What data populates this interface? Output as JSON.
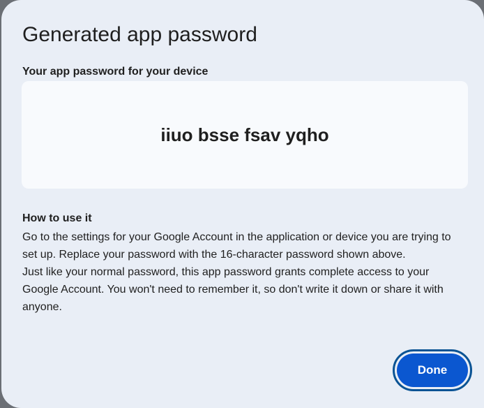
{
  "dialog": {
    "title": "Generated app password",
    "subtitle": "Your app password for your device",
    "password": "iiuo bsse fsav yqho",
    "howto": {
      "heading": "How to use it",
      "paragraph1": "Go to the settings for your Google Account in the application or device you are trying to set up. Replace your password with the 16-character password shown above.",
      "paragraph2": "Just like your normal password, this app password grants complete access to your Google Account. You won't need to remember it, so don't write it down or share it with anyone."
    },
    "done_label": "Done"
  },
  "colors": {
    "dialog_bg": "#e9eef6",
    "password_box_bg": "#f8fafd",
    "primary_button": "#0b57d0",
    "focus_ring": "#0a5394"
  }
}
